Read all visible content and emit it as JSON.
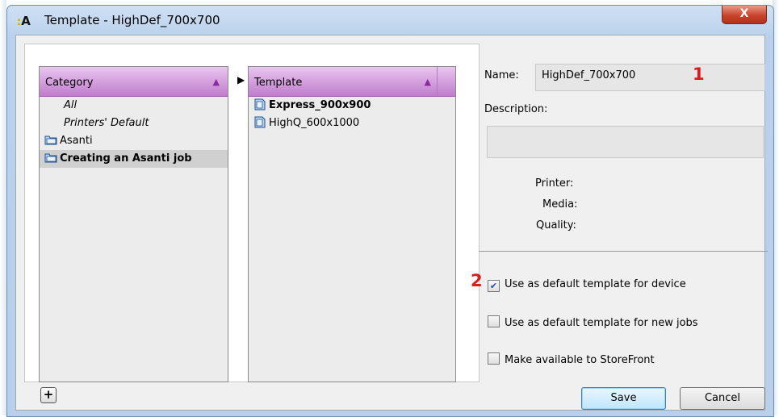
{
  "window": {
    "app_icon_text": "A",
    "title": "Template - HighDef_700x700",
    "close_label": "X"
  },
  "category_list": {
    "header": "Category",
    "items": [
      {
        "label": "All",
        "style": "italic"
      },
      {
        "label": "Printers' Default",
        "style": "italic"
      },
      {
        "label": "Asanti",
        "style": "normal",
        "icon": "folder-icon"
      },
      {
        "label": "Creating an Asanti job",
        "style": "bold",
        "icon": "folder-icon",
        "selected": true
      }
    ]
  },
  "template_list": {
    "header": "Template",
    "items": [
      {
        "label": "Express_900x900",
        "style": "bold",
        "icon": "folder-icon"
      },
      {
        "label": "HighQ_600x1000",
        "style": "normal",
        "icon": "folder-icon"
      }
    ]
  },
  "add_button_label": "+",
  "details": {
    "name_label": "Name:",
    "name_value": "HighDef_700x700",
    "description_label": "Description:",
    "description_value": "",
    "printer_label": "Printer:",
    "media_label": "Media:",
    "quality_label": "Quality:"
  },
  "markers": {
    "one": "1",
    "two": "2"
  },
  "options": [
    {
      "label": "Use as default template for device",
      "checked": true
    },
    {
      "label": "Use as default template for new jobs",
      "checked": false
    },
    {
      "label": "Make available to StoreFront",
      "checked": false
    }
  ],
  "buttons": {
    "save": "Save",
    "cancel": "Cancel"
  },
  "colors": {
    "marker_red": "#e0191c",
    "list_header": "#c07ccc",
    "titlebar": "#b9d1ec"
  }
}
